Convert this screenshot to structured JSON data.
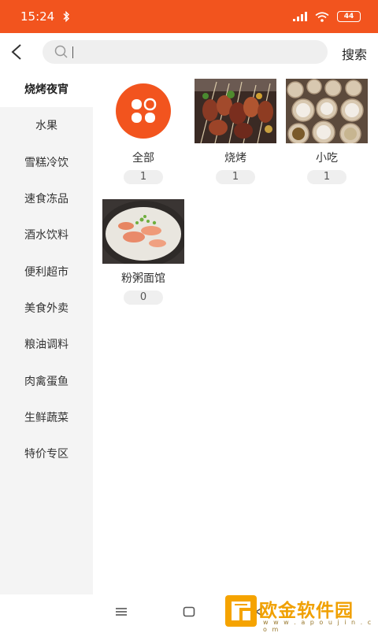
{
  "status_bar": {
    "time": "15:24",
    "battery": "44",
    "bluetooth_icon": "bluetooth-icon",
    "signal_icon": "signal-icon",
    "wifi_icon": "wifi-icon"
  },
  "header": {
    "back_icon": "chevron-left-icon",
    "search_placeholder": "",
    "search_value": "",
    "search_label": "搜索"
  },
  "sidebar": {
    "items": [
      {
        "label": "烧烤夜宵",
        "active": true
      },
      {
        "label": "水果",
        "active": false
      },
      {
        "label": "雪糕冷饮",
        "active": false
      },
      {
        "label": "速食冻品",
        "active": false
      },
      {
        "label": "酒水饮料",
        "active": false
      },
      {
        "label": "便利超市",
        "active": false
      },
      {
        "label": "美食外卖",
        "active": false
      },
      {
        "label": "粮油调料",
        "active": false
      },
      {
        "label": "肉禽蛋鱼",
        "active": false
      },
      {
        "label": "生鲜蔬菜",
        "active": false
      },
      {
        "label": "特价专区",
        "active": false
      }
    ]
  },
  "categories": [
    {
      "label": "全部",
      "count": "1",
      "image": "all-categories-icon"
    },
    {
      "label": "烧烤",
      "count": "1",
      "image": "bbq-skewers-photo"
    },
    {
      "label": "小吃",
      "count": "1",
      "image": "snack-bowls-photo"
    },
    {
      "label": "粉粥面馆",
      "count": "0",
      "image": "shrimp-porridge-photo"
    }
  ],
  "colors": {
    "accent": "#f2541e",
    "sidebar_bg": "#f4f4f4",
    "pill_bg": "#efefef"
  },
  "nav_bar": {
    "menu_icon": "menu-icon",
    "home_icon": "home-icon",
    "back_icon": "back-triangle-icon"
  },
  "watermark": {
    "text": "欧金软件园",
    "url": "w w w . a p o u j i n . c o m"
  }
}
